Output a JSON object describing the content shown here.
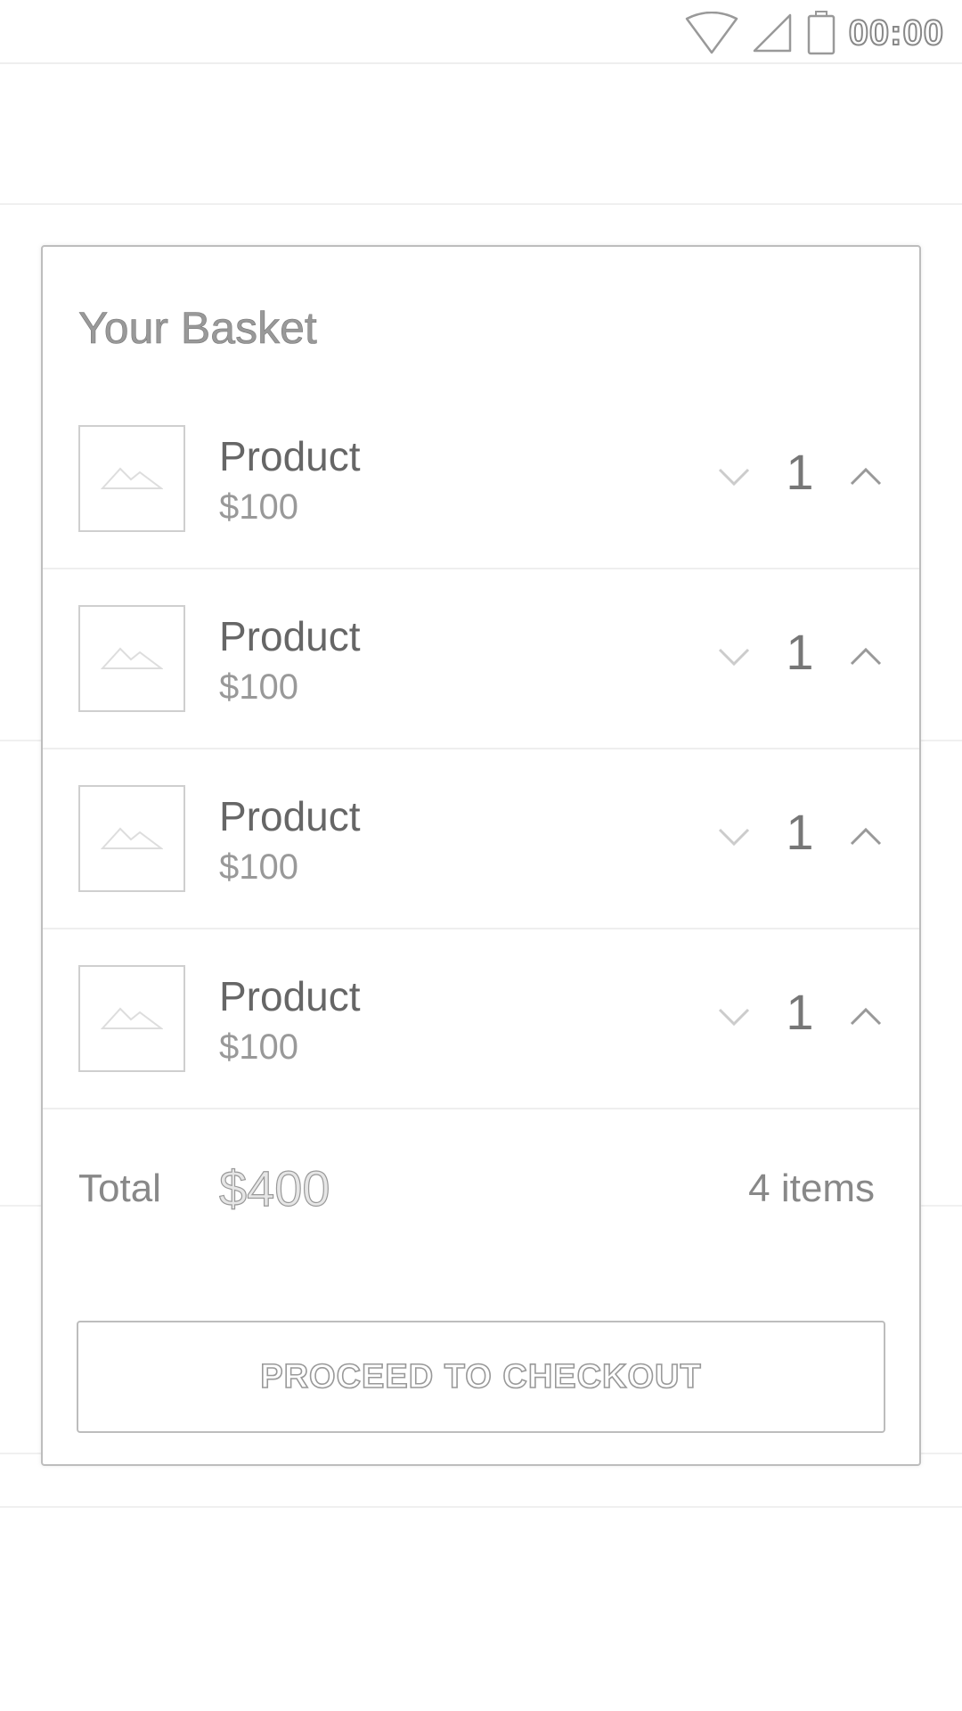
{
  "status_bar": {
    "time": "00:00",
    "icons": [
      "wifi-icon",
      "signal-icon",
      "battery-icon"
    ]
  },
  "basket": {
    "title": "Your Basket",
    "items": [
      {
        "name": "Product",
        "price": "$100",
        "quantity": "1",
        "thumbnail_icon": "image-placeholder-icon"
      },
      {
        "name": "Product",
        "price": "$100",
        "quantity": "1",
        "thumbnail_icon": "image-placeholder-icon"
      },
      {
        "name": "Product",
        "price": "$100",
        "quantity": "1",
        "thumbnail_icon": "image-placeholder-icon"
      },
      {
        "name": "Product",
        "price": "$100",
        "quantity": "1",
        "thumbnail_icon": "image-placeholder-icon"
      }
    ],
    "total_label": "Total",
    "total_value": "$400",
    "item_count": "4 items",
    "checkout_label": "PROCEED TO CHECKOUT"
  },
  "colors": {
    "border": "#bdbdbd",
    "divider": "#eeeeee",
    "text_primary": "#666666",
    "text_secondary": "#999999"
  }
}
